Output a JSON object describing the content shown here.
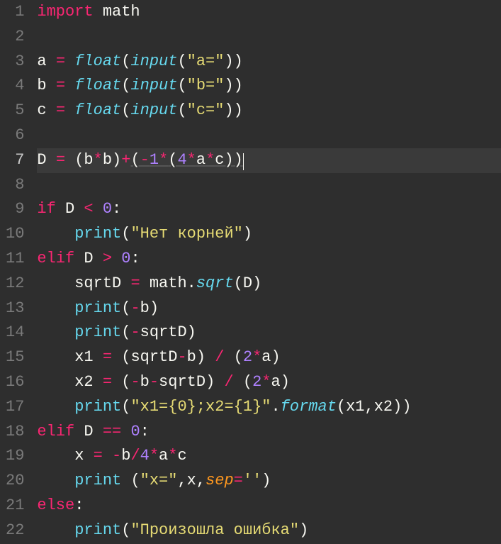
{
  "editor": {
    "current_line": 7,
    "cursor_col_after": "))",
    "lines": [
      {
        "n": 1,
        "tokens": [
          [
            "kw",
            "import"
          ],
          [
            "sp",
            " "
          ],
          [
            "id",
            "math"
          ]
        ]
      },
      {
        "n": 2,
        "tokens": []
      },
      {
        "n": 3,
        "tokens": [
          [
            "id",
            "a"
          ],
          [
            "sp",
            " "
          ],
          [
            "op",
            "="
          ],
          [
            "sp",
            " "
          ],
          [
            "fn",
            "float"
          ],
          [
            "punc",
            "("
          ],
          [
            "fn",
            "input"
          ],
          [
            "punc",
            "("
          ],
          [
            "str",
            "\"a=\""
          ],
          [
            "punc",
            "))"
          ]
        ]
      },
      {
        "n": 4,
        "tokens": [
          [
            "id",
            "b"
          ],
          [
            "sp",
            " "
          ],
          [
            "op",
            "="
          ],
          [
            "sp",
            " "
          ],
          [
            "fn",
            "float"
          ],
          [
            "punc",
            "("
          ],
          [
            "fn",
            "input"
          ],
          [
            "punc",
            "("
          ],
          [
            "str",
            "\"b=\""
          ],
          [
            "punc",
            "))"
          ]
        ]
      },
      {
        "n": 5,
        "tokens": [
          [
            "id",
            "c"
          ],
          [
            "sp",
            " "
          ],
          [
            "op",
            "="
          ],
          [
            "sp",
            " "
          ],
          [
            "fn",
            "float"
          ],
          [
            "punc",
            "("
          ],
          [
            "fn",
            "input"
          ],
          [
            "punc",
            "("
          ],
          [
            "str",
            "\"c=\""
          ],
          [
            "punc",
            "))"
          ]
        ]
      },
      {
        "n": 6,
        "tokens": []
      },
      {
        "n": 7,
        "tokens": [
          [
            "id",
            "D"
          ],
          [
            "sp",
            " "
          ],
          [
            "op",
            "="
          ],
          [
            "sp",
            " "
          ],
          [
            "punc",
            "("
          ],
          [
            "id",
            "b"
          ],
          [
            "op",
            "*"
          ],
          [
            "id",
            "b"
          ],
          [
            "punc",
            ")"
          ],
          [
            "op",
            "+"
          ],
          [
            "punc-u",
            "("
          ],
          [
            "op-u",
            "-"
          ],
          [
            "num-u",
            "1"
          ],
          [
            "op-u",
            "*"
          ],
          [
            "punc-u",
            "("
          ],
          [
            "num-u",
            "4"
          ],
          [
            "op-u",
            "*"
          ],
          [
            "id-u",
            "a"
          ],
          [
            "op-u",
            "*"
          ],
          [
            "id-u",
            "c"
          ],
          [
            "punc-u",
            "))"
          ],
          [
            "cursor",
            ""
          ]
        ]
      },
      {
        "n": 8,
        "tokens": []
      },
      {
        "n": 9,
        "tokens": [
          [
            "kw",
            "if"
          ],
          [
            "sp",
            " "
          ],
          [
            "id",
            "D"
          ],
          [
            "sp",
            " "
          ],
          [
            "op",
            "<"
          ],
          [
            "sp",
            " "
          ],
          [
            "num",
            "0"
          ],
          [
            "punc",
            ":"
          ]
        ]
      },
      {
        "n": 10,
        "tokens": [
          [
            "sp",
            "    "
          ],
          [
            "call",
            "print"
          ],
          [
            "punc",
            "("
          ],
          [
            "str",
            "\"Нет корней\""
          ],
          [
            "punc",
            ")"
          ]
        ]
      },
      {
        "n": 11,
        "tokens": [
          [
            "kw",
            "elif"
          ],
          [
            "sp",
            " "
          ],
          [
            "id",
            "D"
          ],
          [
            "sp",
            " "
          ],
          [
            "op",
            ">"
          ],
          [
            "sp",
            " "
          ],
          [
            "num",
            "0"
          ],
          [
            "punc",
            ":"
          ]
        ]
      },
      {
        "n": 12,
        "tokens": [
          [
            "sp",
            "    "
          ],
          [
            "id",
            "sqrtD"
          ],
          [
            "sp",
            " "
          ],
          [
            "op",
            "="
          ],
          [
            "sp",
            " "
          ],
          [
            "id",
            "math"
          ],
          [
            "punc",
            "."
          ],
          [
            "fn",
            "sqrt"
          ],
          [
            "punc",
            "("
          ],
          [
            "id",
            "D"
          ],
          [
            "punc",
            ")"
          ]
        ]
      },
      {
        "n": 13,
        "tokens": [
          [
            "sp",
            "    "
          ],
          [
            "call",
            "print"
          ],
          [
            "punc",
            "("
          ],
          [
            "op",
            "-"
          ],
          [
            "id",
            "b"
          ],
          [
            "punc",
            ")"
          ]
        ]
      },
      {
        "n": 14,
        "tokens": [
          [
            "sp",
            "    "
          ],
          [
            "call",
            "print"
          ],
          [
            "punc",
            "("
          ],
          [
            "op",
            "-"
          ],
          [
            "id",
            "sqrtD"
          ],
          [
            "punc",
            ")"
          ]
        ]
      },
      {
        "n": 15,
        "tokens": [
          [
            "sp",
            "    "
          ],
          [
            "id",
            "x1"
          ],
          [
            "sp",
            " "
          ],
          [
            "op",
            "="
          ],
          [
            "sp",
            " "
          ],
          [
            "punc",
            "("
          ],
          [
            "id",
            "sqrtD"
          ],
          [
            "op",
            "-"
          ],
          [
            "id",
            "b"
          ],
          [
            "punc",
            ")"
          ],
          [
            "sp",
            " "
          ],
          [
            "op",
            "/"
          ],
          [
            "sp",
            " "
          ],
          [
            "punc",
            "("
          ],
          [
            "num",
            "2"
          ],
          [
            "op",
            "*"
          ],
          [
            "id",
            "a"
          ],
          [
            "punc",
            ")"
          ]
        ]
      },
      {
        "n": 16,
        "tokens": [
          [
            "sp",
            "    "
          ],
          [
            "id",
            "x2"
          ],
          [
            "sp",
            " "
          ],
          [
            "op",
            "="
          ],
          [
            "sp",
            " "
          ],
          [
            "punc",
            "("
          ],
          [
            "op",
            "-"
          ],
          [
            "id",
            "b"
          ],
          [
            "op",
            "-"
          ],
          [
            "id",
            "sqrtD"
          ],
          [
            "punc",
            ")"
          ],
          [
            "sp",
            " "
          ],
          [
            "op",
            "/"
          ],
          [
            "sp",
            " "
          ],
          [
            "punc",
            "("
          ],
          [
            "num",
            "2"
          ],
          [
            "op",
            "*"
          ],
          [
            "id",
            "a"
          ],
          [
            "punc",
            ")"
          ]
        ]
      },
      {
        "n": 17,
        "tokens": [
          [
            "sp",
            "    "
          ],
          [
            "call",
            "print"
          ],
          [
            "punc",
            "("
          ],
          [
            "str",
            "\"x1={0};x2={1}\""
          ],
          [
            "punc",
            "."
          ],
          [
            "fn",
            "format"
          ],
          [
            "punc",
            "("
          ],
          [
            "id",
            "x1"
          ],
          [
            "punc",
            ","
          ],
          [
            "id",
            "x2"
          ],
          [
            "punc",
            "))"
          ]
        ]
      },
      {
        "n": 18,
        "tokens": [
          [
            "kw",
            "elif"
          ],
          [
            "sp",
            " "
          ],
          [
            "id",
            "D"
          ],
          [
            "sp",
            " "
          ],
          [
            "op",
            "=="
          ],
          [
            "sp",
            " "
          ],
          [
            "num",
            "0"
          ],
          [
            "punc",
            ":"
          ]
        ]
      },
      {
        "n": 19,
        "tokens": [
          [
            "sp",
            "    "
          ],
          [
            "id",
            "x"
          ],
          [
            "sp",
            " "
          ],
          [
            "op",
            "="
          ],
          [
            "sp",
            " "
          ],
          [
            "op",
            "-"
          ],
          [
            "id",
            "b"
          ],
          [
            "op",
            "/"
          ],
          [
            "num",
            "4"
          ],
          [
            "op",
            "*"
          ],
          [
            "id",
            "a"
          ],
          [
            "op",
            "*"
          ],
          [
            "id",
            "c"
          ]
        ]
      },
      {
        "n": 20,
        "tokens": [
          [
            "sp",
            "    "
          ],
          [
            "call",
            "print"
          ],
          [
            "sp",
            " "
          ],
          [
            "punc",
            "("
          ],
          [
            "str",
            "\"x=\""
          ],
          [
            "punc",
            ","
          ],
          [
            "id",
            "x"
          ],
          [
            "punc",
            ","
          ],
          [
            "arg",
            "sep"
          ],
          [
            "op",
            "="
          ],
          [
            "str",
            "''"
          ],
          [
            "punc",
            ")"
          ]
        ]
      },
      {
        "n": 21,
        "tokens": [
          [
            "kw",
            "else"
          ],
          [
            "punc",
            ":"
          ]
        ]
      },
      {
        "n": 22,
        "tokens": [
          [
            "sp",
            "    "
          ],
          [
            "call",
            "print"
          ],
          [
            "punc",
            "("
          ],
          [
            "str",
            "\"Произошла ошибка\""
          ],
          [
            "punc",
            ")"
          ]
        ]
      }
    ]
  }
}
